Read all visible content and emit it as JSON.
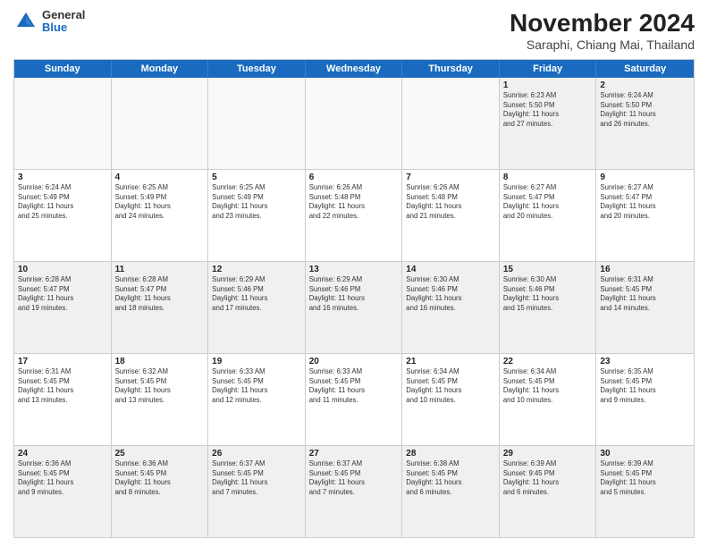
{
  "logo": {
    "general": "General",
    "blue": "Blue"
  },
  "title": {
    "month": "November 2024",
    "location": "Saraphi, Chiang Mai, Thailand"
  },
  "header_days": [
    "Sunday",
    "Monday",
    "Tuesday",
    "Wednesday",
    "Thursday",
    "Friday",
    "Saturday"
  ],
  "weeks": [
    [
      {
        "day": "",
        "empty": true,
        "lines": []
      },
      {
        "day": "",
        "empty": true,
        "lines": []
      },
      {
        "day": "",
        "empty": true,
        "lines": []
      },
      {
        "day": "",
        "empty": true,
        "lines": []
      },
      {
        "day": "",
        "empty": true,
        "lines": []
      },
      {
        "day": "1",
        "empty": false,
        "lines": [
          "Sunrise: 6:23 AM",
          "Sunset: 5:50 PM",
          "Daylight: 11 hours",
          "and 27 minutes."
        ]
      },
      {
        "day": "2",
        "empty": false,
        "lines": [
          "Sunrise: 6:24 AM",
          "Sunset: 5:50 PM",
          "Daylight: 11 hours",
          "and 26 minutes."
        ]
      }
    ],
    [
      {
        "day": "3",
        "empty": false,
        "lines": [
          "Sunrise: 6:24 AM",
          "Sunset: 5:49 PM",
          "Daylight: 11 hours",
          "and 25 minutes."
        ]
      },
      {
        "day": "4",
        "empty": false,
        "lines": [
          "Sunrise: 6:25 AM",
          "Sunset: 5:49 PM",
          "Daylight: 11 hours",
          "and 24 minutes."
        ]
      },
      {
        "day": "5",
        "empty": false,
        "lines": [
          "Sunrise: 6:25 AM",
          "Sunset: 5:49 PM",
          "Daylight: 11 hours",
          "and 23 minutes."
        ]
      },
      {
        "day": "6",
        "empty": false,
        "lines": [
          "Sunrise: 6:26 AM",
          "Sunset: 5:48 PM",
          "Daylight: 11 hours",
          "and 22 minutes."
        ]
      },
      {
        "day": "7",
        "empty": false,
        "lines": [
          "Sunrise: 6:26 AM",
          "Sunset: 5:48 PM",
          "Daylight: 11 hours",
          "and 21 minutes."
        ]
      },
      {
        "day": "8",
        "empty": false,
        "lines": [
          "Sunrise: 6:27 AM",
          "Sunset: 5:47 PM",
          "Daylight: 11 hours",
          "and 20 minutes."
        ]
      },
      {
        "day": "9",
        "empty": false,
        "lines": [
          "Sunrise: 6:27 AM",
          "Sunset: 5:47 PM",
          "Daylight: 11 hours",
          "and 20 minutes."
        ]
      }
    ],
    [
      {
        "day": "10",
        "empty": false,
        "lines": [
          "Sunrise: 6:28 AM",
          "Sunset: 5:47 PM",
          "Daylight: 11 hours",
          "and 19 minutes."
        ]
      },
      {
        "day": "11",
        "empty": false,
        "lines": [
          "Sunrise: 6:28 AM",
          "Sunset: 5:47 PM",
          "Daylight: 11 hours",
          "and 18 minutes."
        ]
      },
      {
        "day": "12",
        "empty": false,
        "lines": [
          "Sunrise: 6:29 AM",
          "Sunset: 5:46 PM",
          "Daylight: 11 hours",
          "and 17 minutes."
        ]
      },
      {
        "day": "13",
        "empty": false,
        "lines": [
          "Sunrise: 6:29 AM",
          "Sunset: 5:46 PM",
          "Daylight: 11 hours",
          "and 16 minutes."
        ]
      },
      {
        "day": "14",
        "empty": false,
        "lines": [
          "Sunrise: 6:30 AM",
          "Sunset: 5:46 PM",
          "Daylight: 11 hours",
          "and 16 minutes."
        ]
      },
      {
        "day": "15",
        "empty": false,
        "lines": [
          "Sunrise: 6:30 AM",
          "Sunset: 5:46 PM",
          "Daylight: 11 hours",
          "and 15 minutes."
        ]
      },
      {
        "day": "16",
        "empty": false,
        "lines": [
          "Sunrise: 6:31 AM",
          "Sunset: 5:45 PM",
          "Daylight: 11 hours",
          "and 14 minutes."
        ]
      }
    ],
    [
      {
        "day": "17",
        "empty": false,
        "lines": [
          "Sunrise: 6:31 AM",
          "Sunset: 5:45 PM",
          "Daylight: 11 hours",
          "and 13 minutes."
        ]
      },
      {
        "day": "18",
        "empty": false,
        "lines": [
          "Sunrise: 6:32 AM",
          "Sunset: 5:45 PM",
          "Daylight: 11 hours",
          "and 13 minutes."
        ]
      },
      {
        "day": "19",
        "empty": false,
        "lines": [
          "Sunrise: 6:33 AM",
          "Sunset: 5:45 PM",
          "Daylight: 11 hours",
          "and 12 minutes."
        ]
      },
      {
        "day": "20",
        "empty": false,
        "lines": [
          "Sunrise: 6:33 AM",
          "Sunset: 5:45 PM",
          "Daylight: 11 hours",
          "and 11 minutes."
        ]
      },
      {
        "day": "21",
        "empty": false,
        "lines": [
          "Sunrise: 6:34 AM",
          "Sunset: 5:45 PM",
          "Daylight: 11 hours",
          "and 10 minutes."
        ]
      },
      {
        "day": "22",
        "empty": false,
        "lines": [
          "Sunrise: 6:34 AM",
          "Sunset: 5:45 PM",
          "Daylight: 11 hours",
          "and 10 minutes."
        ]
      },
      {
        "day": "23",
        "empty": false,
        "lines": [
          "Sunrise: 6:35 AM",
          "Sunset: 5:45 PM",
          "Daylight: 11 hours",
          "and 9 minutes."
        ]
      }
    ],
    [
      {
        "day": "24",
        "empty": false,
        "lines": [
          "Sunrise: 6:36 AM",
          "Sunset: 5:45 PM",
          "Daylight: 11 hours",
          "and 9 minutes."
        ]
      },
      {
        "day": "25",
        "empty": false,
        "lines": [
          "Sunrise: 6:36 AM",
          "Sunset: 5:45 PM",
          "Daylight: 11 hours",
          "and 8 minutes."
        ]
      },
      {
        "day": "26",
        "empty": false,
        "lines": [
          "Sunrise: 6:37 AM",
          "Sunset: 5:45 PM",
          "Daylight: 11 hours",
          "and 7 minutes."
        ]
      },
      {
        "day": "27",
        "empty": false,
        "lines": [
          "Sunrise: 6:37 AM",
          "Sunset: 5:45 PM",
          "Daylight: 11 hours",
          "and 7 minutes."
        ]
      },
      {
        "day": "28",
        "empty": false,
        "lines": [
          "Sunrise: 6:38 AM",
          "Sunset: 5:45 PM",
          "Daylight: 11 hours",
          "and 6 minutes."
        ]
      },
      {
        "day": "29",
        "empty": false,
        "lines": [
          "Sunrise: 6:39 AM",
          "Sunset: 9:45 PM",
          "Daylight: 11 hours",
          "and 6 minutes."
        ]
      },
      {
        "day": "30",
        "empty": false,
        "lines": [
          "Sunrise: 6:39 AM",
          "Sunset: 5:45 PM",
          "Daylight: 11 hours",
          "and 5 minutes."
        ]
      }
    ]
  ]
}
